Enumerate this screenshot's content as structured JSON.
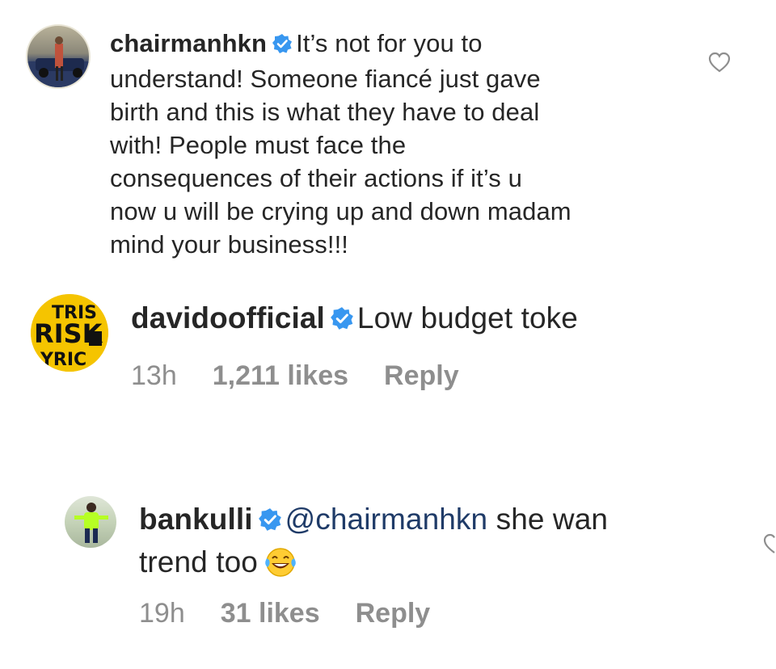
{
  "comments": [
    {
      "username": "chairmanhkn",
      "text": "It’s not for you to understand! Someone fiancé just gave birth and this is what they have to deal with! People must face the consequences of their actions if it’s u now u will be crying up and down madam mind your business!!!",
      "lines": [
        "It’s not for you to",
        "understand! Someone fiancé just gave",
        "birth and this is what they have to deal",
        "with! People must face the",
        "consequences of their actions if it’s u",
        "now u will be crying up and down madam",
        "mind your business!!!"
      ],
      "verified": true
    },
    {
      "username": "davidoofficial",
      "text": "Low budget toke",
      "time": "13h",
      "likes": "1,211 likes",
      "reply": "Reply",
      "verified": true,
      "avatar_text": [
        "TRIS",
        "RISK",
        "YRIC"
      ]
    },
    {
      "username": "bankulli",
      "mention": "@chairmanhkn",
      "text_line1": "she wan",
      "text_line2": "trend too",
      "time": "19h",
      "likes": "31 likes",
      "reply": "Reply",
      "verified": true,
      "emoji": "face-with-tears-of-joy"
    }
  ],
  "colors": {
    "text": "#262626",
    "meta": "#8e8e8e",
    "verified_badge": "#3897f0",
    "mention": "#1f3b68"
  }
}
